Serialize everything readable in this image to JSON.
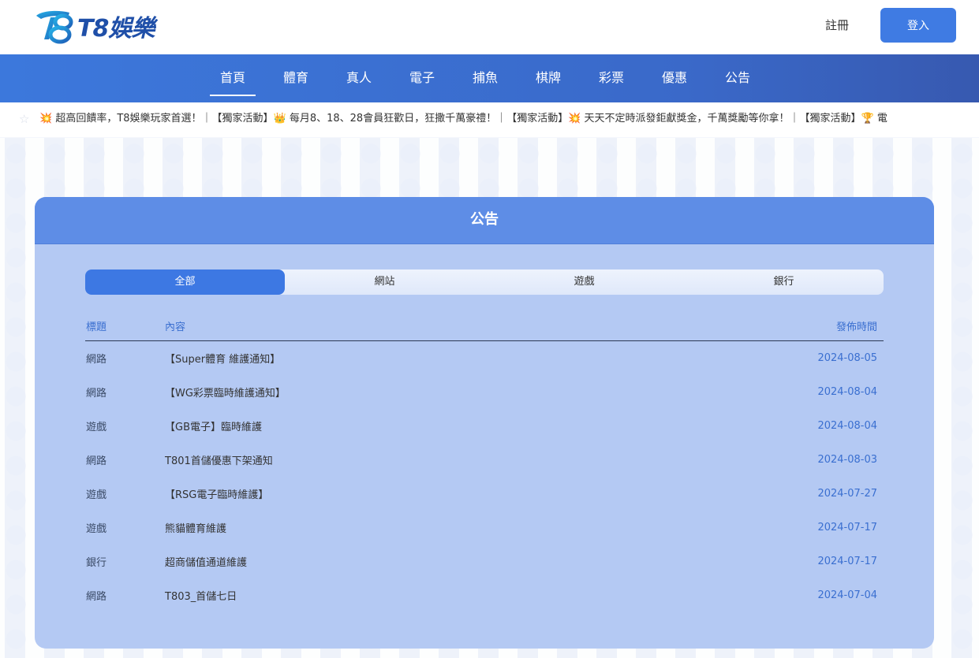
{
  "brand": {
    "logo_text": "T8娛樂",
    "accent": "#3f7be3"
  },
  "header": {
    "register_label": "註冊",
    "login_label": "登入"
  },
  "nav": {
    "items": [
      {
        "label": "首頁",
        "active": true
      },
      {
        "label": "體育"
      },
      {
        "label": "真人"
      },
      {
        "label": "電子"
      },
      {
        "label": "捕魚"
      },
      {
        "label": "棋牌"
      },
      {
        "label": "彩票"
      },
      {
        "label": "優惠"
      },
      {
        "label": "公告"
      }
    ]
  },
  "marquee": {
    "icon": "star-icon",
    "text": "💥 超高回饋率，T8娛樂玩家首選！｜【獨家活動】👑 每月8、18、28會員狂歡日，狂撒千萬豪禮！｜【獨家活動】💥 天天不定時派發鉅獻獎金，千萬獎勵等你拿！｜【獨家活動】🏆 電"
  },
  "panel": {
    "title": "公告",
    "tabs": [
      {
        "label": "全部",
        "active": true
      },
      {
        "label": "網站"
      },
      {
        "label": "遊戲"
      },
      {
        "label": "銀行"
      }
    ],
    "columns": {
      "category": "標題",
      "content": "內容",
      "date": "發佈時間"
    },
    "rows": [
      {
        "category": "網路",
        "content": "【Super體育 維護通知】",
        "date": "2024-08-05"
      },
      {
        "category": "網路",
        "content": "【WG彩票臨時維護通知】",
        "date": "2024-08-04"
      },
      {
        "category": "遊戲",
        "content": "【GB電子】臨時維護",
        "date": "2024-08-04"
      },
      {
        "category": "網路",
        "content": "T801首儲優惠下架通知",
        "date": "2024-08-03"
      },
      {
        "category": "遊戲",
        "content": "【RSG電子臨時維護】",
        "date": "2024-07-27"
      },
      {
        "category": "遊戲",
        "content": "熊貓體育維護",
        "date": "2024-07-17"
      },
      {
        "category": "銀行",
        "content": "超商儲值通道維護",
        "date": "2024-07-17"
      },
      {
        "category": "網路",
        "content": "T803_首儲七日",
        "date": "2024-07-04"
      }
    ]
  }
}
